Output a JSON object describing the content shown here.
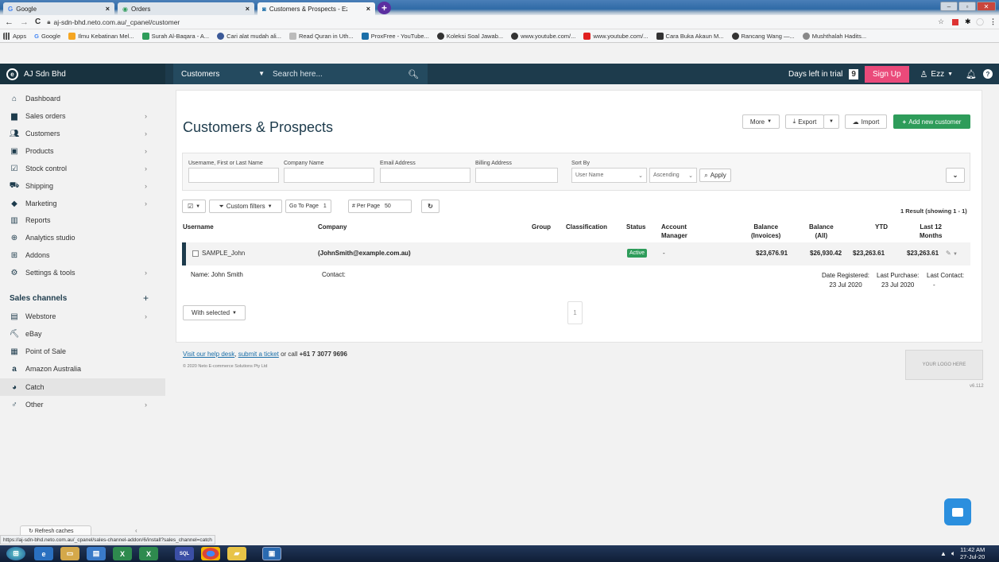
{
  "browser": {
    "tabs": [
      {
        "label": "Google"
      },
      {
        "label": "Orders"
      },
      {
        "label": "Customers & Prospects - Ezz - A"
      }
    ],
    "url": "aj-sdn-bhd.neto.com.au/_cpanel/customer",
    "bookmarks": [
      "Apps",
      "Google",
      "Ilmu Kebatinan Mel...",
      "Surah Al-Baqara - A...",
      "Cari alat mudah ali...",
      "Read Quran in Uth...",
      "ProxFree - YouTube...",
      "Koleksi Soal Jawab...",
      "www.youtube.com/...",
      "www.youtube.com/...",
      "Cara Buka Akaun M...",
      "Rancang Wang —...",
      "Mushthalah Hadits..."
    ],
    "status_url": "https://aj-sdn-bhd.neto.com.au/_cpanel/sales-channel-addon/6/install?sales_channel=catch"
  },
  "app": {
    "brand": "AJ Sdn Bhd",
    "search_scope": "Customers",
    "search_placeholder": "Search here...",
    "trial_label": "Days left in trial",
    "trial_days": "9",
    "signup": "Sign Up",
    "user": "Ezz"
  },
  "sidebar": {
    "items": [
      {
        "label": "Dashboard"
      },
      {
        "label": "Sales orders"
      },
      {
        "label": "Customers"
      },
      {
        "label": "Products"
      },
      {
        "label": "Stock control"
      },
      {
        "label": "Shipping"
      },
      {
        "label": "Marketing"
      },
      {
        "label": "Reports"
      },
      {
        "label": "Analytics studio"
      },
      {
        "label": "Addons"
      },
      {
        "label": "Settings & tools"
      }
    ],
    "section": "Sales channels",
    "channels": [
      {
        "label": "Webstore"
      },
      {
        "label": "eBay"
      },
      {
        "label": "Point of Sale"
      },
      {
        "label": "Amazon Australia"
      },
      {
        "label": "Catch"
      },
      {
        "label": "Other"
      }
    ],
    "refresh": "Refresh caches"
  },
  "page": {
    "title": "Customers & Prospects",
    "actions": {
      "more": "More",
      "export": "Export",
      "import": "Import",
      "add": "Add new customer"
    },
    "filters": {
      "username_label": "Username, First or Last Name",
      "company_label": "Company Name",
      "email_label": "Email Address",
      "billing_label": "Billing Address",
      "sort_label": "Sort By",
      "sort_value": "User Name",
      "order_value": "Ascending",
      "apply": "Apply"
    },
    "toolbar": {
      "custom_filters": "Custom filters",
      "goto_label": "Go To Page",
      "goto_value": "1",
      "perpage_label": "# Per Page",
      "perpage_value": "50",
      "result": "1 Result (showing 1 - 1)"
    },
    "columns": {
      "username": "Username",
      "company": "Company",
      "group": "Group",
      "classification": "Classification",
      "status": "Status",
      "account_manager_1": "Account",
      "account_manager_2": "Manager",
      "bal_inv_1": "Balance",
      "bal_inv_2": "(Invoices)",
      "bal_all_1": "Balance",
      "bal_all_2": "(All)",
      "ytd": "YTD",
      "last12_1": "Last 12",
      "last12_2": "Months"
    },
    "row": {
      "username": "SAMPLE_John",
      "company": "(JohnSmith@example.com.au)",
      "status": "Active",
      "account_manager": "-",
      "balance_invoices": "$23,676.91",
      "balance_all": "$26,930.42",
      "ytd": "$23,263.61",
      "last12": "$23,263.61",
      "name": "Name: John Smith",
      "contact": "Contact:",
      "date_registered_label": "Date Registered:",
      "date_registered": "23 Jul 2020",
      "last_purchase_label": "Last Purchase:",
      "last_purchase": "23 Jul 2020",
      "last_contact_label": "Last Contact:",
      "last_contact": "-"
    },
    "with_selected": "With selected",
    "pager": "1"
  },
  "footer": {
    "help": "Visit our help desk",
    "ticket": "submit a ticket",
    "call": "or call",
    "phone": "+61 7 3077 9696",
    "copyright": "© 2020 Neto E-commerce Solutions Pty Ltd",
    "logo_placeholder": "YOUR LOGO HERE",
    "version": "v6.112"
  },
  "taskbar": {
    "time": "11:42 AM",
    "date": "27-Jul-20"
  }
}
